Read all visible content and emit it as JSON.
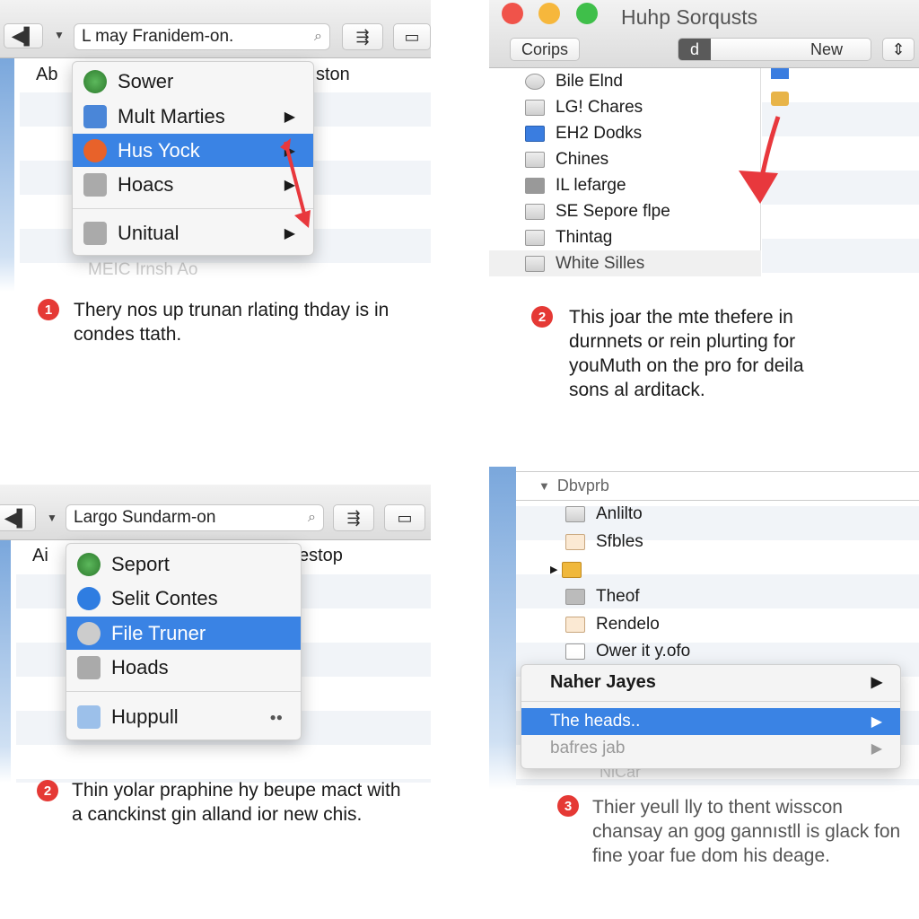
{
  "panel1": {
    "search": "L may Franidem-on.",
    "header_left": "Ab",
    "header_right": "ston",
    "menu": [
      {
        "label": "Sower",
        "submenu": false
      },
      {
        "label": "Mult Marties",
        "submenu": true
      },
      {
        "label": "Hus Yock",
        "submenu": true,
        "selected": true
      },
      {
        "label": "Hoacs",
        "submenu": true
      },
      {
        "label": "Unitual",
        "submenu": true
      }
    ],
    "faded_row": "MEIC Irnsh Ao",
    "step": "1",
    "caption": "Thery nos up trunan rlating thday is in condes ttath."
  },
  "panel2": {
    "window_title": "Huhp Sorqusts",
    "toolbar": {
      "left_button": "Corips",
      "segment_active": "d",
      "segment_label": "New"
    },
    "files": [
      "Bile Elnd",
      "LG! Chares",
      "EH2 Dodks",
      "Chines",
      "IL lefarge",
      "SE Sepore flpe",
      "Thintag",
      "White Silles"
    ],
    "step": "2",
    "caption": "This joar the mte thefere in durnnets or rein plurting for youMuth on the pro for deila sons al arditack."
  },
  "panel3": {
    "search": "Largo Sundarm-on",
    "header_left": "Ai",
    "header_right": "estop",
    "menu": [
      {
        "label": "Seport"
      },
      {
        "label": "Selit Contes"
      },
      {
        "label": "File Truner",
        "selected": true
      },
      {
        "label": "Hoads"
      },
      {
        "label": "Huppull"
      }
    ],
    "step": "2",
    "caption": "Thin yolar praphine hy beupe mact with a canckinst gin alland ior new chis."
  },
  "panel4": {
    "group": "Dbvprb",
    "files": [
      "Anlilto",
      "Sfbles",
      "",
      "Theof",
      "Rendelo",
      "Ower it y.ofo"
    ],
    "menu": [
      {
        "label": "Naher Jayes"
      },
      {
        "label": "The heads..",
        "selected": true
      },
      {
        "label": "bafres jab",
        "disabled": true
      }
    ],
    "faded_row": "NiCar",
    "step": "3",
    "caption": "Thier yeull lly to thent wisscon chansay an gog gannıstll is glack fon fine yoar fue dom his deage."
  },
  "colors": {
    "accent": "#3a83e4",
    "badge": "#e53935",
    "arrow": "#e8383d"
  }
}
